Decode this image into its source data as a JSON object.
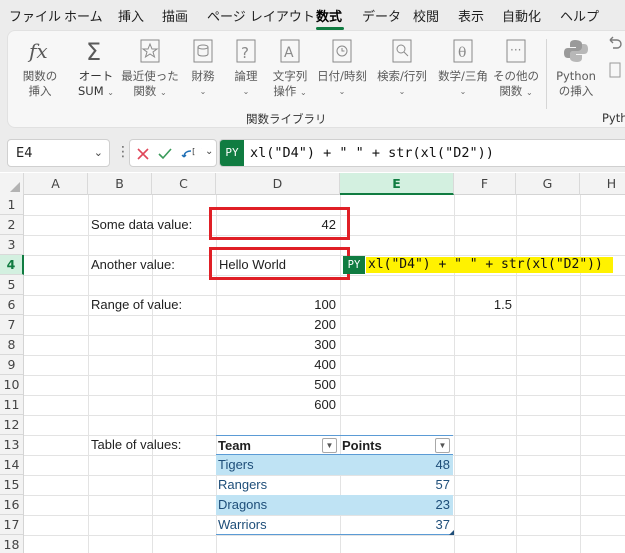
{
  "menu": {
    "items": [
      "ファイル",
      "ホーム",
      "挿入",
      "描画",
      "ページ レイアウト",
      "数式",
      "データ",
      "校閲",
      "表示",
      "自動化",
      "ヘルプ"
    ],
    "active_index": 5
  },
  "ribbon": {
    "buttons": [
      {
        "label1": "関数の",
        "label2": "挿入",
        "icon": "fx-icon"
      },
      {
        "label1": "オート",
        "label2": "SUM",
        "icon": "sigma-icon"
      },
      {
        "label1": "最近使った",
        "label2": "関数",
        "icon": "star-icon"
      },
      {
        "label1": "財務",
        "label2": "",
        "icon": "database-icon"
      },
      {
        "label1": "論理",
        "label2": "",
        "icon": "question-icon"
      },
      {
        "label1": "文字列",
        "label2": "操作",
        "icon": "text-icon"
      },
      {
        "label1": "日付/時刻",
        "label2": "",
        "icon": "clock-icon"
      },
      {
        "label1": "検索/行列",
        "label2": "",
        "icon": "search-icon"
      },
      {
        "label1": "数学/三角",
        "label2": "",
        "icon": "theta-icon"
      },
      {
        "label1": "その他の",
        "label2": "関数",
        "icon": "more-functions-icon"
      },
      {
        "label1": "Python",
        "label2": "の挿入",
        "icon": "python-icon"
      }
    ],
    "group_label": "関数ライブラリ",
    "clipped_label": "Pyth"
  },
  "formula_bar": {
    "name_box": "E4",
    "py_badge": "PY",
    "formula": "xl(\"D4\") + \" \" + str(xl(\"D2\"))"
  },
  "grid": {
    "columns": [
      "A",
      "B",
      "C",
      "D",
      "E",
      "F",
      "G",
      "H"
    ],
    "rows": [
      "1",
      "2",
      "3",
      "4",
      "5",
      "6",
      "7",
      "8",
      "9",
      "10",
      "11",
      "12",
      "13",
      "14",
      "15",
      "16",
      "17",
      "18"
    ],
    "selected_column": "E",
    "selected_row": "4",
    "labels": {
      "b2": "Some data value:",
      "b4": "Another value:",
      "b6": "Range of value:",
      "b13": "Table of values:"
    },
    "d2": "42",
    "d4": "Hello World",
    "e4_badge": "PY",
    "e4_formula": "xl(\"D4\") + \" \" + str(xl(\"D2\"))",
    "f6": "1.5",
    "range_values": [
      "100",
      "200",
      "300",
      "400",
      "500",
      "600"
    ]
  },
  "table": {
    "headers": [
      "Team",
      "Points"
    ],
    "rows": [
      {
        "team": "Tigers",
        "points": "48"
      },
      {
        "team": "Rangers",
        "points": "57"
      },
      {
        "team": "Dragons",
        "points": "23"
      },
      {
        "team": "Warriors",
        "points": "37"
      }
    ]
  },
  "colors": {
    "accent": "#107c41",
    "highlight_box": "#e01f26",
    "formula_highlight": "#fff200",
    "table_band": "#bfe3f4",
    "table_text": "#1e4e79"
  }
}
